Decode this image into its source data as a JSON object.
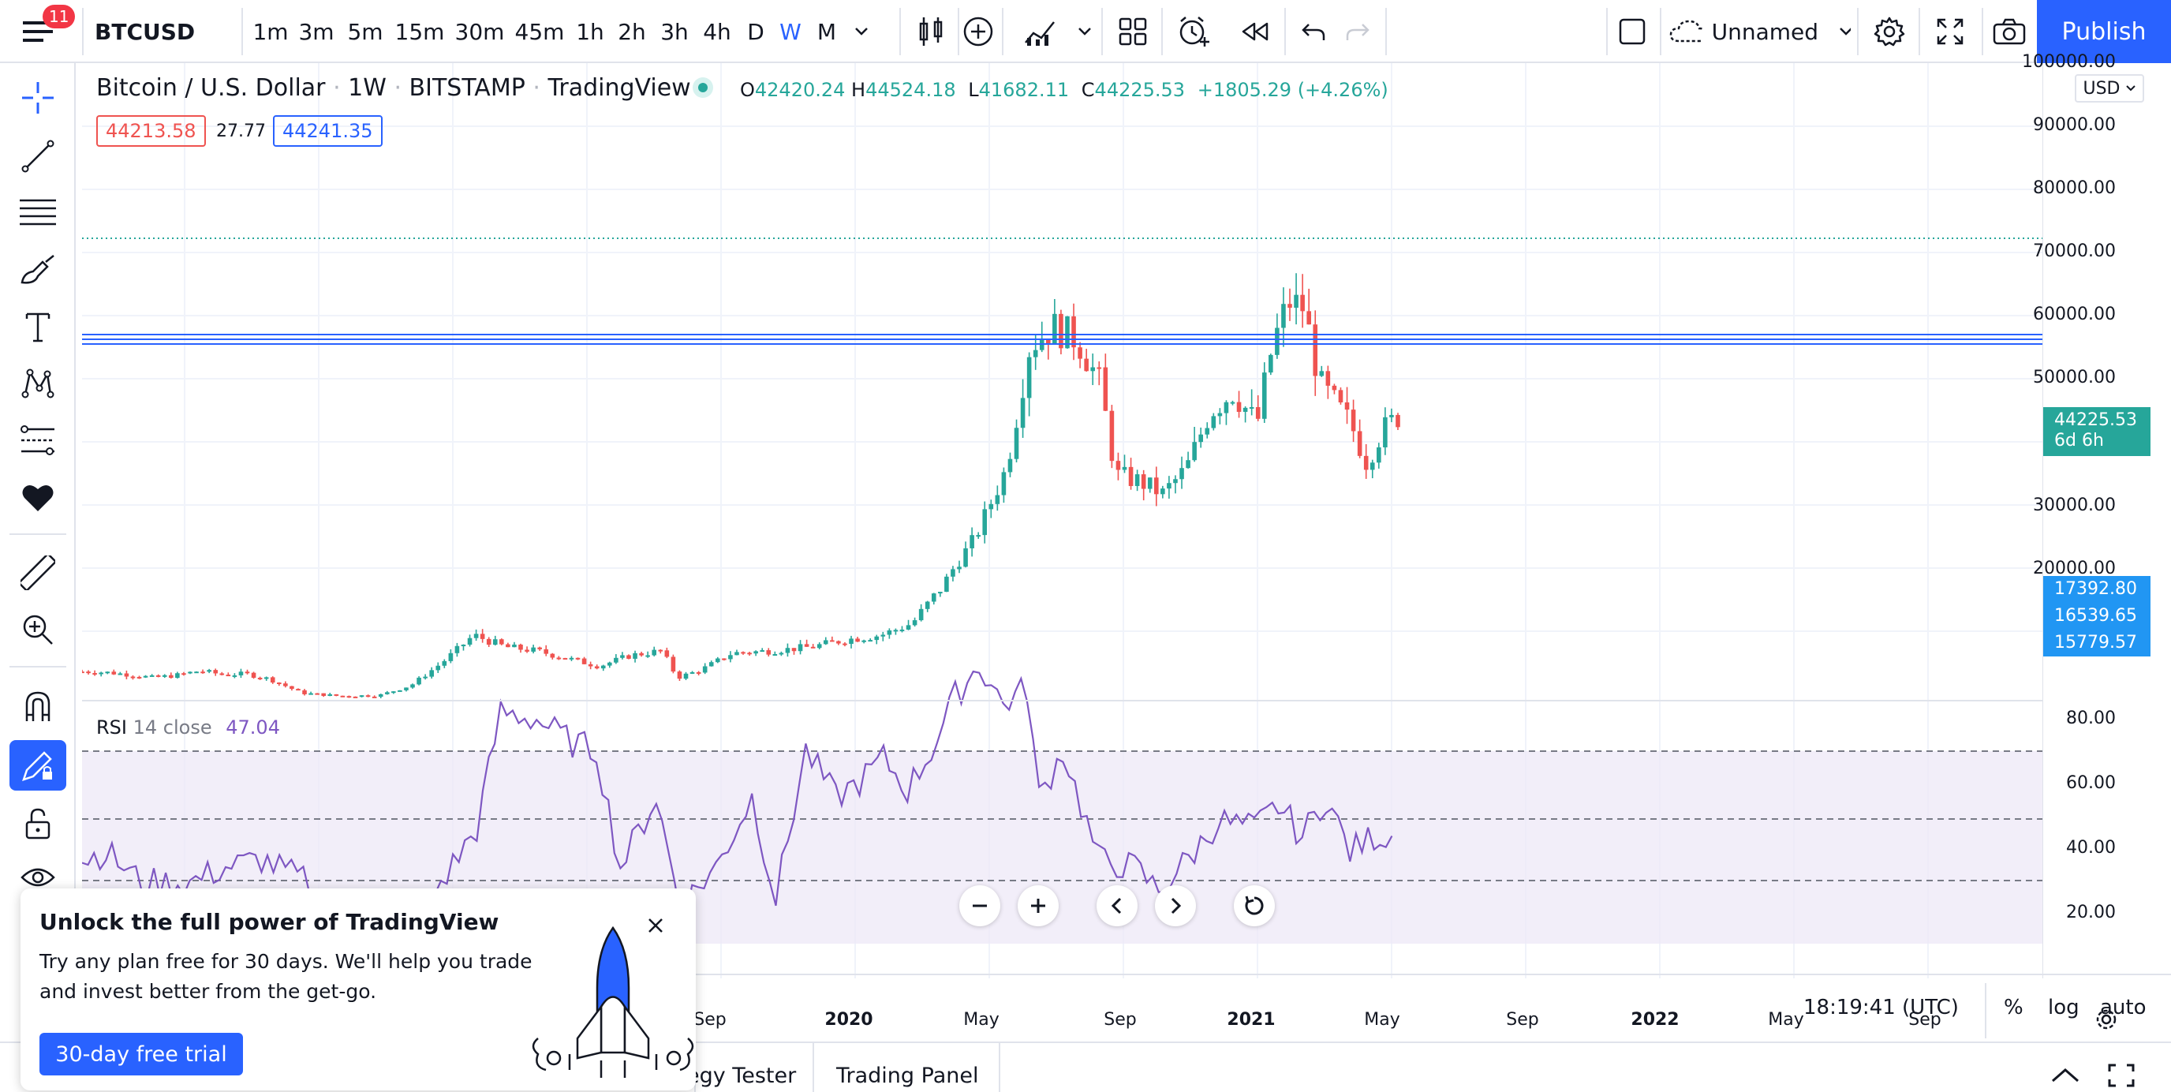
{
  "topbar": {
    "notif_count": "11",
    "symbol": "BTCUSD",
    "intervals": [
      "1m",
      "3m",
      "5m",
      "15m",
      "30m",
      "45m",
      "1h",
      "2h",
      "3h",
      "4h",
      "D",
      "W",
      "M"
    ],
    "active_interval": "W",
    "layout_name": "Unnamed",
    "publish_label": "Publish"
  },
  "chart": {
    "title": "Bitcoin / U.S. Dollar",
    "interval": "1W",
    "exchange": "BITSTAMP",
    "source": "TradingView",
    "ohlc": {
      "o_label": "O",
      "o": "42420.24",
      "h_label": "H",
      "h": "44524.18",
      "l_label": "L",
      "l": "41682.11",
      "c_label": "C",
      "c": "44225.53",
      "change": "+1805.29 (+4.26%)"
    },
    "bid": "44213.58",
    "spread": "27.77",
    "ask": "44241.35",
    "currency": "USD",
    "price_axis": [
      "100000.00",
      "90000.00",
      "80000.00",
      "70000.00",
      "60000.00",
      "50000.00",
      "30000.00",
      "20000.00"
    ],
    "last_price": "44225.53",
    "countdown": "6d 6h",
    "hlines": [
      "17392.80",
      "16539.65",
      "15779.57"
    ],
    "rsi_label": "RSI",
    "rsi_params": "14 close",
    "rsi_value": "47.04",
    "rsi_axis": [
      "80.00",
      "60.00",
      "40.00",
      "20.00"
    ],
    "dates": [
      "Sep",
      "2020",
      "May",
      "Sep",
      "2021",
      "May",
      "Sep",
      "2022",
      "May",
      "Sep"
    ],
    "time": "18:19:41 (UTC)",
    "scale_percent": "%",
    "scale_log": "log",
    "scale_auto": "auto",
    "colors": {
      "up": "#26a69a",
      "down": "#ef5350",
      "rsi": "#7e57c2",
      "hline": "#2962ff",
      "accent": "#2962ff"
    }
  },
  "promo": {
    "title": "Unlock the full power of TradingView",
    "body_line1": "Try any plan free for 30 days. We'll help you trade",
    "body_line2": "and invest better from the get-go.",
    "cta": "30-day free trial"
  },
  "bottom_tabs": [
    "egy Tester",
    "Trading Panel"
  ]
}
